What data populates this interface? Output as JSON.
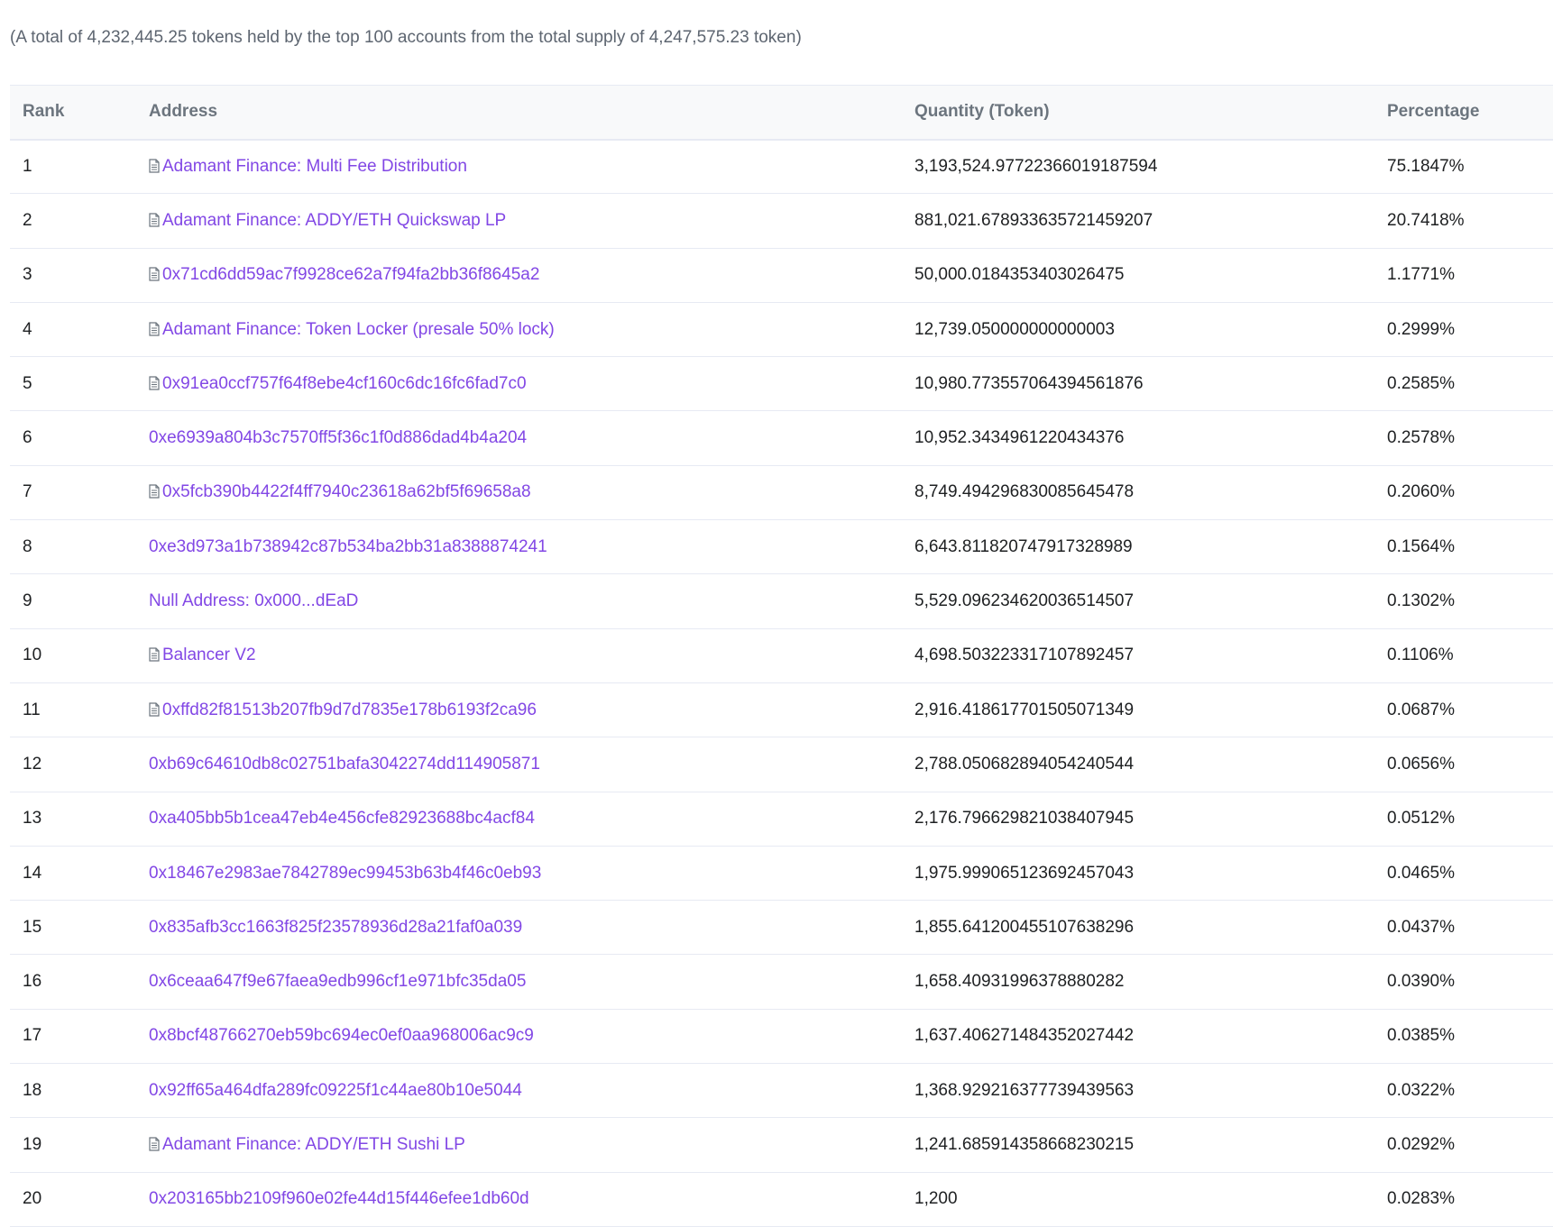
{
  "summary": "(A total of 4,232,445.25 tokens held by the top 100 accounts from the total supply of 4,247,575.23 token)",
  "table": {
    "headers": {
      "rank": "Rank",
      "address": "Address",
      "quantity": "Quantity (Token)",
      "percentage": "Percentage"
    },
    "rows": [
      {
        "rank": "1",
        "address": "Adamant Finance: Multi Fee Distribution",
        "is_contract": true,
        "quantity": "3,193,524.97722366019187594",
        "percentage": "75.1847%"
      },
      {
        "rank": "2",
        "address": "Adamant Finance: ADDY/ETH Quickswap LP",
        "is_contract": true,
        "quantity": "881,021.678933635721459207",
        "percentage": "20.7418%"
      },
      {
        "rank": "3",
        "address": "0x71cd6dd59ac7f9928ce62a7f94fa2bb36f8645a2",
        "is_contract": true,
        "quantity": "50,000.0184353403026475",
        "percentage": "1.1771%"
      },
      {
        "rank": "4",
        "address": "Adamant Finance: Token Locker (presale 50% lock)",
        "is_contract": true,
        "quantity": "12,739.050000000000003",
        "percentage": "0.2999%"
      },
      {
        "rank": "5",
        "address": "0x91ea0ccf757f64f8ebe4cf160c6dc16fc6fad7c0",
        "is_contract": true,
        "quantity": "10,980.773557064394561876",
        "percentage": "0.2585%"
      },
      {
        "rank": "6",
        "address": "0xe6939a804b3c7570ff5f36c1f0d886dad4b4a204",
        "is_contract": false,
        "quantity": "10,952.3434961220434376",
        "percentage": "0.2578%"
      },
      {
        "rank": "7",
        "address": "0x5fcb390b4422f4ff7940c23618a62bf5f69658a8",
        "is_contract": true,
        "quantity": "8,749.494296830085645478",
        "percentage": "0.2060%"
      },
      {
        "rank": "8",
        "address": "0xe3d973a1b738942c87b534ba2bb31a8388874241",
        "is_contract": false,
        "quantity": "6,643.811820747917328989",
        "percentage": "0.1564%"
      },
      {
        "rank": "9",
        "address": "Null Address: 0x000...dEaD",
        "is_contract": false,
        "quantity": "5,529.096234620036514507",
        "percentage": "0.1302%"
      },
      {
        "rank": "10",
        "address": "Balancer V2",
        "is_contract": true,
        "quantity": "4,698.503223317107892457",
        "percentage": "0.1106%"
      },
      {
        "rank": "11",
        "address": "0xffd82f81513b207fb9d7d7835e178b6193f2ca96",
        "is_contract": true,
        "quantity": "2,916.418617701505071349",
        "percentage": "0.0687%"
      },
      {
        "rank": "12",
        "address": "0xb69c64610db8c02751bafa3042274dd114905871",
        "is_contract": false,
        "quantity": "2,788.050682894054240544",
        "percentage": "0.0656%"
      },
      {
        "rank": "13",
        "address": "0xa405bb5b1cea47eb4e456cfe82923688bc4acf84",
        "is_contract": false,
        "quantity": "2,176.796629821038407945",
        "percentage": "0.0512%"
      },
      {
        "rank": "14",
        "address": "0x18467e2983ae7842789ec99453b63b4f46c0eb93",
        "is_contract": false,
        "quantity": "1,975.999065123692457043",
        "percentage": "0.0465%"
      },
      {
        "rank": "15",
        "address": "0x835afb3cc1663f825f23578936d28a21faf0a039",
        "is_contract": false,
        "quantity": "1,855.641200455107638296",
        "percentage": "0.0437%"
      },
      {
        "rank": "16",
        "address": "0x6ceaa647f9e67faea9edb996cf1e971bfc35da05",
        "is_contract": false,
        "quantity": "1,658.40931996378880282",
        "percentage": "0.0390%"
      },
      {
        "rank": "17",
        "address": "0x8bcf48766270eb59bc694ec0ef0aa968006ac9c9",
        "is_contract": false,
        "quantity": "1,637.406271484352027442",
        "percentage": "0.0385%"
      },
      {
        "rank": "18",
        "address": "0x92ff65a464dfa289fc09225f1c44ae80b10e5044",
        "is_contract": false,
        "quantity": "1,368.929216377739439563",
        "percentage": "0.0322%"
      },
      {
        "rank": "19",
        "address": "Adamant Finance: ADDY/ETH Sushi LP",
        "is_contract": true,
        "quantity": "1,241.685914358668230215",
        "percentage": "0.0292%"
      },
      {
        "rank": "20",
        "address": "0x203165bb2109f960e02fe44d15f446efee1db60d",
        "is_contract": false,
        "quantity": "1,200",
        "percentage": "0.0283%"
      }
    ]
  },
  "colors": {
    "link": "#8247e5",
    "summary_text": "#5d6570",
    "header_text": "#6c757e",
    "header_bg": "#f8f9fa",
    "row_border": "#e7eaf3"
  },
  "icons": {
    "contract": "file-document-icon"
  }
}
